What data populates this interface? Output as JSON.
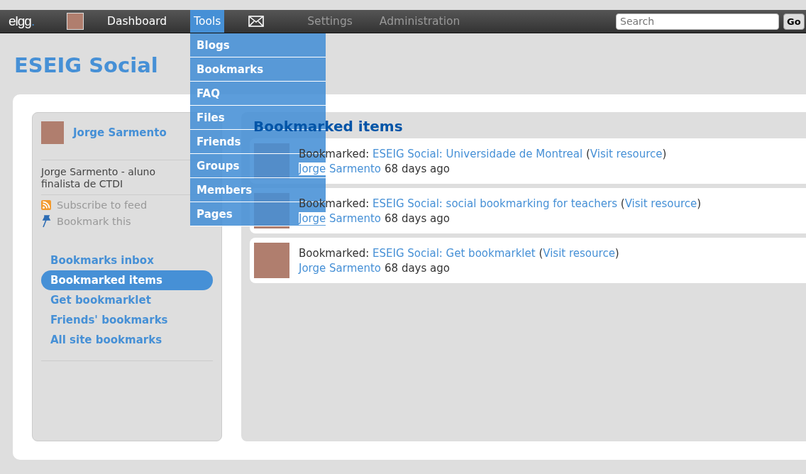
{
  "topbar": {
    "logo": {
      "text": "elgg",
      "mark": "."
    },
    "nav": [
      {
        "kind": "avatar"
      },
      {
        "kind": "text",
        "label": "Dashboard",
        "selected": false,
        "dimmed": false
      },
      {
        "kind": "text",
        "label": "Tools",
        "selected": true,
        "dimmed": false
      },
      {
        "kind": "mail"
      },
      {
        "kind": "text",
        "label": "Settings",
        "selected": false,
        "dimmed": true
      },
      {
        "kind": "text",
        "label": "Administration",
        "selected": false,
        "dimmed": true
      }
    ],
    "search": {
      "placeholder": "Search",
      "button": "Go"
    }
  },
  "tools_menu": {
    "items": [
      "Blogs",
      "Bookmarks",
      "FAQ",
      "Files",
      "Friends",
      "Groups",
      "Members",
      "Pages"
    ]
  },
  "site_title": "ESEIG Social",
  "sidebar": {
    "owner": "Jorge Sarmento",
    "description": "Jorge Sarmento - aluno finalista de CTDI",
    "actions": [
      {
        "kind": "feed",
        "label": "Subscribe to feed"
      },
      {
        "kind": "pin",
        "label": "Bookmark this"
      }
    ],
    "menu": [
      {
        "label": "Bookmarks inbox",
        "selected": false
      },
      {
        "label": "Bookmarked items",
        "selected": true
      },
      {
        "label": "Get bookmarklet",
        "selected": false
      },
      {
        "label": "Friends' bookmarks",
        "selected": false
      },
      {
        "label": "All site bookmarks",
        "selected": false
      }
    ]
  },
  "main": {
    "title": "Bookmarked items",
    "items": [
      {
        "parts": [
          {
            "kind": "text",
            "text": "Bookmarked: "
          },
          {
            "kind": "link",
            "text": "ESEIG Social: Universidade de Montreal"
          },
          {
            "kind": "text",
            "text": " ("
          },
          {
            "kind": "link",
            "text": "Visit resource"
          },
          {
            "kind": "text",
            "text": ")"
          }
        ],
        "author": "Jorge Sarmento",
        "time": "68 days ago"
      },
      {
        "parts": [
          {
            "kind": "text",
            "text": "Bookmarked: "
          },
          {
            "kind": "link",
            "text": "ESEIG Social: social bookmarking for teachers"
          },
          {
            "kind": "text",
            "text": " ("
          },
          {
            "kind": "link",
            "text": "Visit resource"
          },
          {
            "kind": "text",
            "text": ")"
          }
        ],
        "author": "Jorge Sarmento",
        "time": "68 days ago"
      },
      {
        "parts": [
          {
            "kind": "text",
            "text": "Bookmarked: "
          },
          {
            "kind": "link",
            "text": "ESEIG Social: Get bookmarklet"
          },
          {
            "kind": "text",
            "text": " ("
          },
          {
            "kind": "link",
            "text": "Visit resource"
          },
          {
            "kind": "text",
            "text": ")"
          }
        ],
        "author": "Jorge Sarmento",
        "time": "68 days ago"
      }
    ]
  }
}
